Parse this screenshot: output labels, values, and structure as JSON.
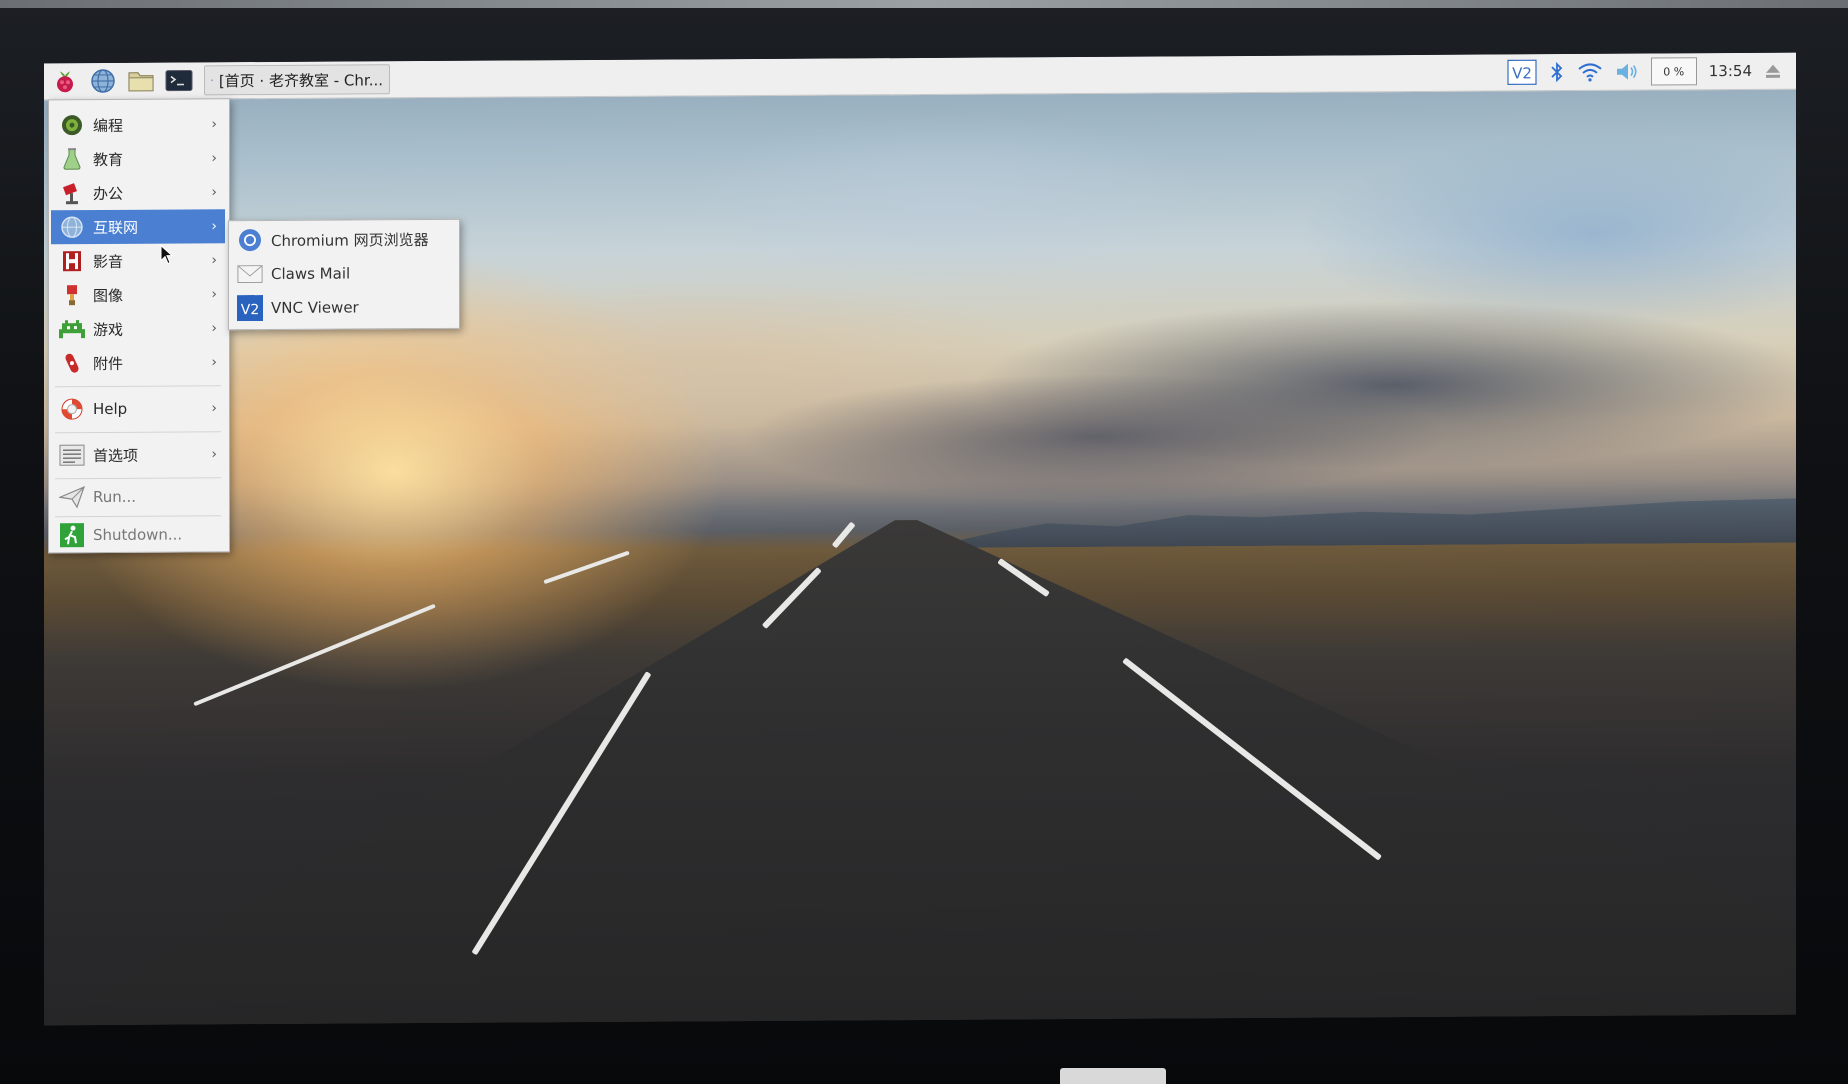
{
  "taskbar": {
    "task_title": "[首页 · 老齐教室 - Chr...",
    "clock": "13:54",
    "cpu_usage": "0 %",
    "tray_vnc_label": "V2"
  },
  "menu": {
    "items": [
      {
        "label": "编程",
        "icon": "programming-icon"
      },
      {
        "label": "教育",
        "icon": "education-icon"
      },
      {
        "label": "办公",
        "icon": "office-icon"
      },
      {
        "label": "互联网",
        "icon": "internet-globe-icon"
      },
      {
        "label": "影音",
        "icon": "sound-video-icon"
      },
      {
        "label": "图像",
        "icon": "graphics-icon"
      },
      {
        "label": "游戏",
        "icon": "games-icon"
      },
      {
        "label": "附件",
        "icon": "accessories-icon"
      },
      {
        "label": "Help",
        "icon": "help-lifebuoy-icon"
      },
      {
        "label": "首选项",
        "icon": "preferences-icon"
      },
      {
        "label": "Run...",
        "icon": "run-paperplane-icon"
      },
      {
        "label": "Shutdown...",
        "icon": "shutdown-icon"
      }
    ],
    "arrow": "›"
  },
  "submenu": {
    "items": [
      {
        "label": "Chromium 网页浏览器",
        "icon": "chromium-icon"
      },
      {
        "label": "Claws Mail",
        "icon": "mail-icon"
      },
      {
        "label": "VNC Viewer",
        "icon": "vnc-viewer-icon"
      }
    ],
    "vnc_icon_text": "V2"
  },
  "colors": {
    "menu_highlight": "#4a7fd1",
    "menu_bg": "#f2f2f2",
    "taskbar_bg": "#efefef"
  }
}
